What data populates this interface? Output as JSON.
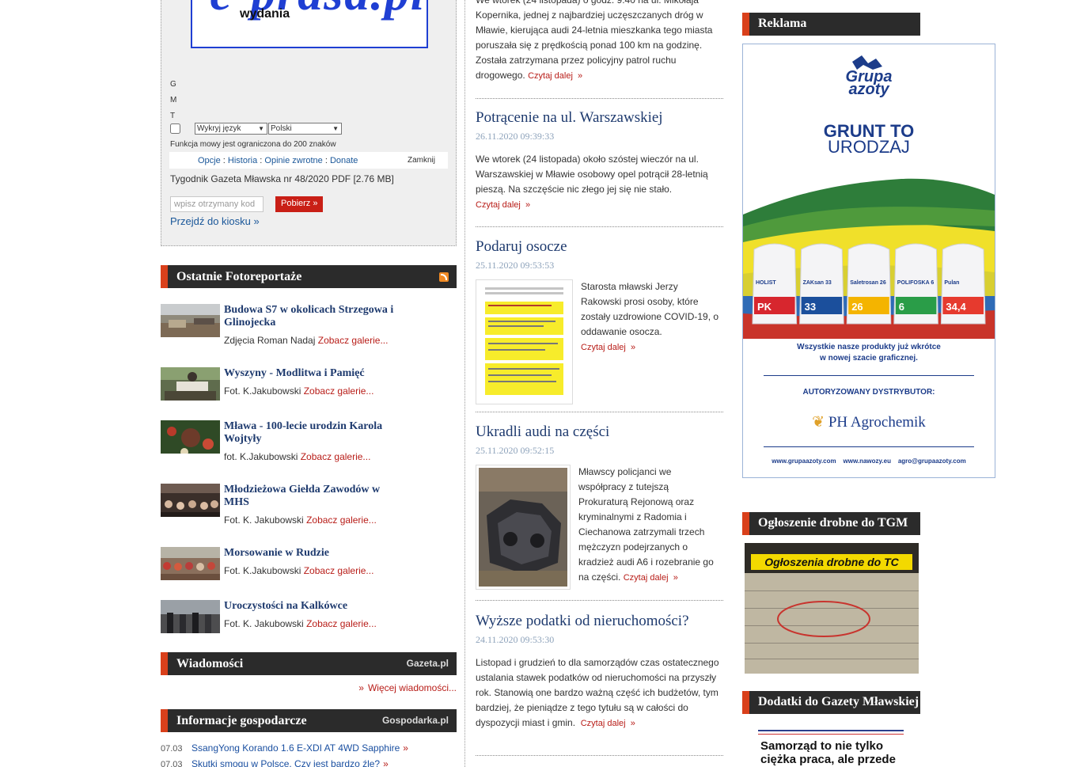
{
  "kiosk": {
    "logo_sub": "wydania",
    "gmt": [
      "G",
      "M",
      "T"
    ],
    "detect_language": "Wykryj język",
    "target_language": "Polski",
    "limit_note": "Funkcja mowy jest ograniczona do 200 znaków",
    "options": "Opcje",
    "history": "Historia",
    "feedback": "Opinie zwrotne",
    "donate": "Donate",
    "close": "Zamknij",
    "pdf_title": "Tygodnik Gazeta Mławska nr 48/2020 PDF [2.76 MB]",
    "code_placeholder": "wpisz otrzymany kod",
    "download_button": "Pobierz »",
    "kiosk_link": "Przejdź do kiosku",
    "kiosk_link_arrow": "»"
  },
  "photo_reports": {
    "heading": "Ostatnie Fotoreportaże",
    "cta": "Zobacz galerie...",
    "items": [
      {
        "title": "Budowa S7 w okolicach Strzegowa i Glinojecka",
        "credit": "Zdjęcia Roman Nadaj"
      },
      {
        "title": "Wyszyny - Modlitwa i Pamięć",
        "credit": "Fot. K.Jakubowski"
      },
      {
        "title": "Mława - 100-lecie urodzin Karola Wojtyły",
        "credit": "fot. K.Jakubowski"
      },
      {
        "title": "Młodzieżowa Giełda Zawodów w MHS",
        "credit": "Fot. K. Jakubowski"
      },
      {
        "title": "Morsowanie w Rudzie",
        "credit": "Fot. K.Jakubowski"
      },
      {
        "title": "Uroczystości na Kalkówce",
        "credit": "Fot. K. Jakubowski"
      }
    ]
  },
  "news": {
    "heading": "Wiadomości",
    "brand": "Gazeta.pl",
    "more_arrow": "»",
    "more": "Więcej wiadomości..."
  },
  "business": {
    "heading": "Informacje gospodarcze",
    "brand": "Gospodarka.pl",
    "arrow": "»",
    "items": [
      {
        "date": "07.03",
        "title": "SsangYong Korando 1.6 E-XDI AT 4WD Sapphire"
      },
      {
        "date": "07.03",
        "title": "Skutki smogu w Polsce. Czy jest bardzo źle?"
      }
    ]
  },
  "articles": {
    "read_more": "Czytaj dalej",
    "read_more_arrow": "»",
    "top_partial": {
      "text": "We wtorek (24 listopada) o godz. 9.40 na ul. Mikołaja Kopernika, jednej z najbardziej uczęszczanych dróg w Mławie, kierująca audi 24-letnia mieszkanka tego miasta poruszała się z prędkością ponad 100 km na godzinę. Została zatrzymana przez policyjny patrol ruchu drogowego."
    },
    "items": [
      {
        "title": "Potrącenie na ul. Warszawskiej",
        "date": "26.11.2020 09:39:33",
        "text": "We wtorek (24 listopada) około szóstej wieczór na ul. Warszawskiej w Mławie osobowy opel potrącił 28-letnią pieszą. Na szczęście nic złego jej się nie stało."
      },
      {
        "title": "Podaruj osocze",
        "date": "25.11.2020 09:53:53",
        "text": "Starosta mławski Jerzy Rakowski prosi osoby, które zostały uzdrowione COVID-19, o oddawanie osocza."
      },
      {
        "title": "Ukradli audi na części",
        "date": "25.11.2020 09:52:15",
        "text": "Mławscy policjanci we współpracy z tutejszą Prokuraturą Rejonową oraz kryminalnymi z Radomia i Ciechanowa zatrzymali trzech mężczyzn podejrzanych o kradzież audi A6 i rozebranie go na części."
      },
      {
        "title": "Wyższe podatki od nieruchomości?",
        "date": "24.11.2020 09:53:30",
        "text": "Listopad i grudzień to dla samorządów czas ostatecznego ustalania stawek podatków od nieruchomości na przyszły rok. Stanowią one bardzo ważną część ich budżetów, tym bardziej, że pieniądze z tego tytułu są w całości do dyspozycji miast i gmin."
      }
    ]
  },
  "sidebar": {
    "ad_heading": "Reklama",
    "ad": {
      "brand_top": "Grupa",
      "brand_bottom": "azoty",
      "slogan_line1": "GRUNT TO",
      "slogan_line2": "URODZAJ",
      "products_line1": "Wszystkie nasze produkty już wkrótce",
      "products_line2": "w nowej szacie graficznej.",
      "distributor": "AUTORYZOWANY DYSTRYBUTOR:",
      "dealer": "PH Agrochemik",
      "urls": "www.grupaazoty.com    www.nawozy.eu    agro@grupaazoty.com",
      "bags": [
        "HOLIST",
        "ZAKsan 33",
        "Saletrosan 26",
        "POLIFOSKA 6",
        "Pulan"
      ],
      "bag_numbers": [
        "PK",
        "33",
        "26",
        "6",
        "34,4"
      ],
      "bag_colors": [
        "#d7262e",
        "#1b4f9c",
        "#f4b400",
        "#2a9d48",
        "#e63a2e"
      ]
    },
    "classifieds_heading": "Ogłoszenie drobne do TGM",
    "classifieds_banner": "Ogłoszenia drobne do TC",
    "supplements_heading": "Dodatki do Gazety Mławskiej",
    "supplement_teaser_line1": "Samorząd to nie tylko",
    "supplement_teaser_line2": "ciężka praca, ale przede"
  }
}
